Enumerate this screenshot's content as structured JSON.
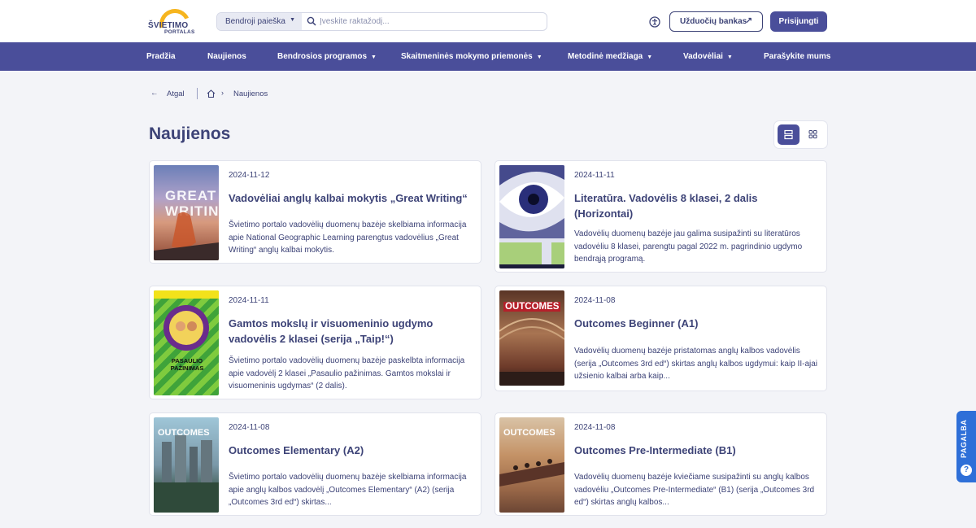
{
  "header": {
    "logo_line1": "ŠVIETIMO",
    "logo_line2": "PORTALAS",
    "search_scope": "Bendroji paieška",
    "search_placeholder": "Įveskite raktažodį...",
    "task_bank_label": "Užduočių bankas",
    "login_label": "Prisijungti"
  },
  "nav": {
    "items": [
      {
        "label": "Pradžia"
      },
      {
        "label": "Naujienos"
      },
      {
        "label": "Bendrosios programos"
      },
      {
        "label": "Skaitmeninės mokymo priemonės"
      },
      {
        "label": "Metodinė medžiaga"
      },
      {
        "label": "Vadovėliai"
      },
      {
        "label": "Parašykite mums"
      }
    ]
  },
  "breadcrumb": {
    "back_label": "Atgal",
    "current": "Naujienos"
  },
  "page": {
    "title": "Naujienos"
  },
  "cover_labels": {
    "great_writing": "GREAT WRITING",
    "outcomes": "OUTCOMES",
    "pasaulio": "PASAULIO PAŽINIMAS"
  },
  "news": [
    {
      "date": "2024-11-12",
      "title": "Vadovėliai anglų kalbai mokytis „Great Writing“",
      "excerpt": "Švietimo portalo vadovėlių duomenų bazėje skelbiama informacija apie National Geographic Learning parengtus vadovėlius „Great Writing“ anglų kalbai mokytis."
    },
    {
      "date": "2024-11-11",
      "title": "Literatūra. Vadovėlis 8 klasei, 2 dalis (Horizontai)",
      "excerpt": "Vadovėlių duomenų bazėje jau galima susipažinti su literatūros vadovėliu 8 klasei, parengtu pagal 2022 m. pagrindinio ugdymo bendrąją programą."
    },
    {
      "date": "2024-11-11",
      "title": "Gamtos mokslų ir visuomeninio ugdymo vadovėlis 2 klasei (serija „Taip!“)",
      "excerpt": "Švietimo portalo vadovėlių duomenų bazėje paskelbta informacija apie vadovėlį 2 klasei „Pasaulio pažinimas. Gamtos mokslai ir visuomeninis ugdymas“ (2 dalis)."
    },
    {
      "date": "2024-11-08",
      "title": "Outcomes Beginner (A1)",
      "excerpt": "Vadovėlių duomenų bazėje pristatomas anglų kalbos vadovėlis (serija „Outcomes 3rd ed“) skirtas anglų kalbos ugdymui: kaip II-ajai užsienio kalbai arba kaip..."
    },
    {
      "date": "2024-11-08",
      "title": "Outcomes Elementary (A2)",
      "excerpt": "Švietimo portalo vadovėlių duomenų bazėje skelbiama informacija apie anglų kalbos vadovėlį „Outcomes Elementary“ (A2) (serija „Outcomes 3rd ed“) skirtas..."
    },
    {
      "date": "2024-11-08",
      "title": "Outcomes Pre-Intermediate (B1)",
      "excerpt": "Vadovėlių duomenų bazėje kviečiame susipažinti  su anglų kalbos vadovėliu „Outcomes Pre-Intermediate“ (B1) (serija „Outcomes 3rd ed“) skirtas anglų kalbos..."
    }
  ],
  "help": {
    "label": "PAGALBA"
  },
  "colors": {
    "primary": "#4a4e9a",
    "text": "#3d4377",
    "background": "#f3f4f8",
    "help": "#2e6fd8",
    "logo_sun": "#f6b51f"
  }
}
